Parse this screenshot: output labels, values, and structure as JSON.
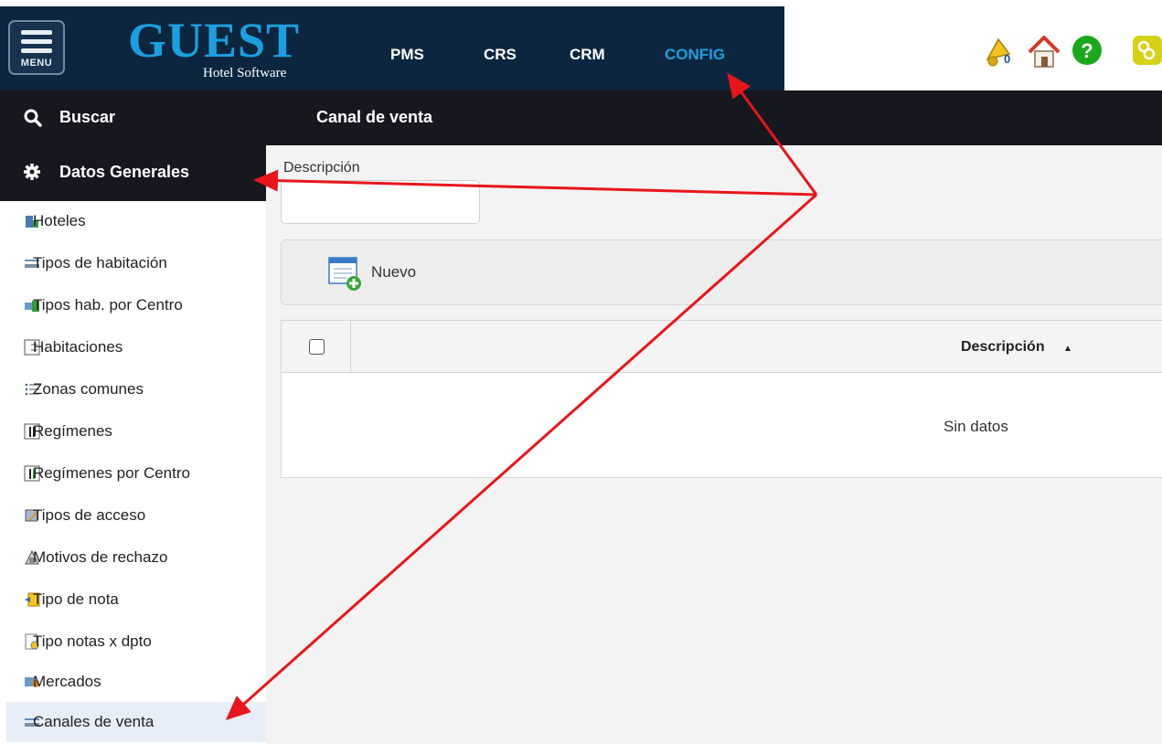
{
  "topbar": {
    "menu_label": "MENU",
    "logo_main": "GUEST",
    "logo_sub": "Hotel Software",
    "nav": [
      {
        "label": "PMS",
        "active": false
      },
      {
        "label": "CRS",
        "active": false
      },
      {
        "label": "CRM",
        "active": false
      },
      {
        "label": "CONFIG",
        "active": true
      }
    ],
    "notification_count": "0",
    "icons": [
      "bell-icon",
      "home-icon",
      "help-icon",
      "link-icon"
    ],
    "colors": {
      "bar": "#0d2640",
      "accent": "#1aa0e0"
    }
  },
  "sidebar": {
    "search_label": "Buscar",
    "section_label": "Datos Generales",
    "items": [
      {
        "label": "Hoteles",
        "icon": "hotel-icon"
      },
      {
        "label": "Tipos de habitación",
        "icon": "room-type-icon"
      },
      {
        "label": "Tipos hab. por Centro",
        "icon": "room-center-icon"
      },
      {
        "label": "Habitaciones",
        "icon": "numbered-list-icon"
      },
      {
        "label": "Zonas comunes",
        "icon": "list-icon"
      },
      {
        "label": "Regímenes",
        "icon": "cutlery-icon"
      },
      {
        "label": "Regímenes por Centro",
        "icon": "cutlery-center-icon"
      },
      {
        "label": "Tipos de acceso",
        "icon": "access-icon"
      },
      {
        "label": "Motivos de rechazo",
        "icon": "reject-icon"
      },
      {
        "label": "Tipo de nota",
        "icon": "note-icon"
      },
      {
        "label": "Tipo notas x dpto",
        "icon": "dept-note-icon"
      },
      {
        "label": "Mercados",
        "icon": "market-icon"
      },
      {
        "label": "Canales de venta",
        "icon": "channel-icon",
        "selected": true
      }
    ]
  },
  "main": {
    "title": "Canal de venta",
    "filter": {
      "label": "Descripción",
      "value": "",
      "placeholder": ""
    },
    "toolbar": {
      "new_label": "Nuevo"
    },
    "grid": {
      "columns": [
        "Descripción"
      ],
      "sort": "ascending",
      "empty_text": "Sin datos",
      "rows": []
    }
  }
}
